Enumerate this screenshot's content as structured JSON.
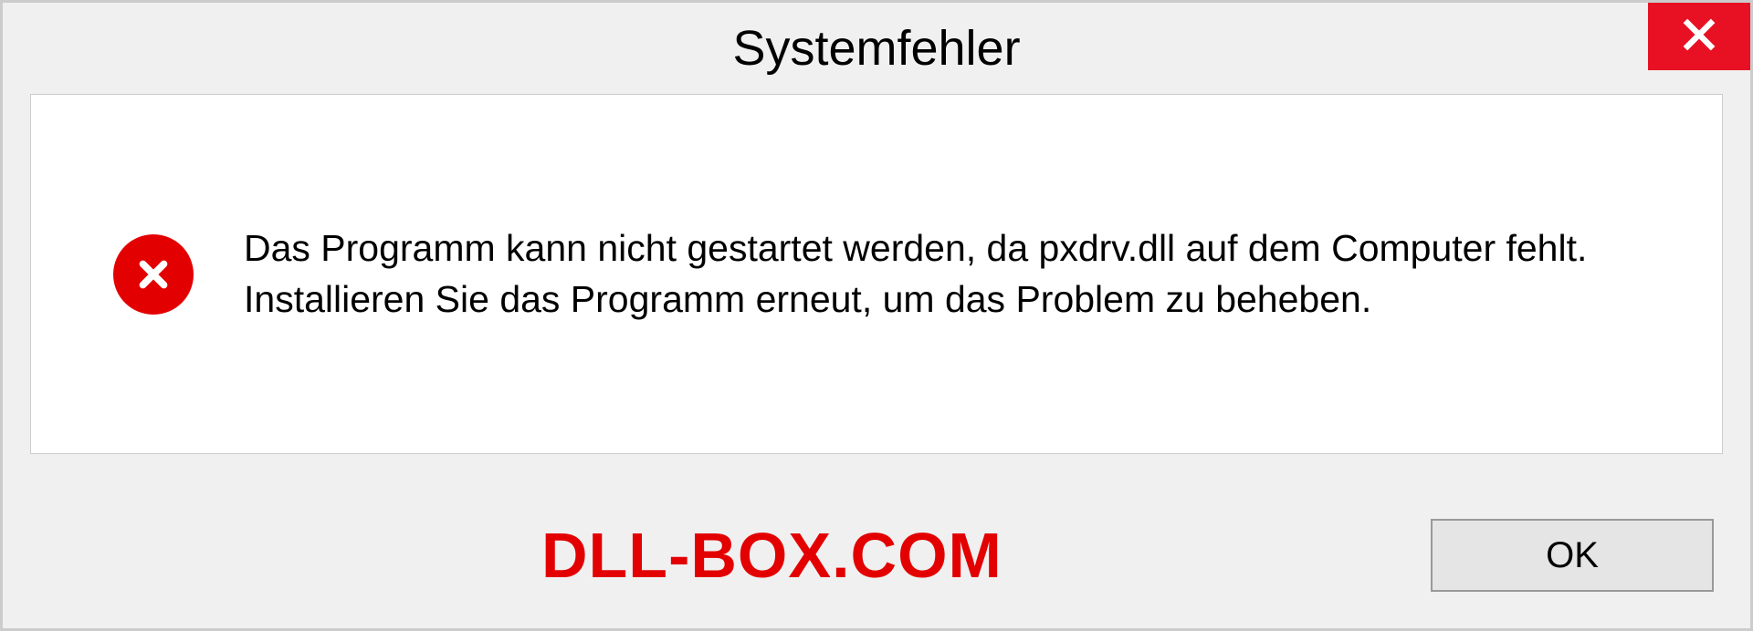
{
  "dialog": {
    "title": "Systemfehler",
    "message": "Das Programm kann nicht gestartet werden, da pxdrv.dll auf dem Computer fehlt. Installieren Sie das Programm erneut, um das Problem zu beheben.",
    "ok_label": "OK"
  },
  "watermark": "DLL-BOX.COM"
}
